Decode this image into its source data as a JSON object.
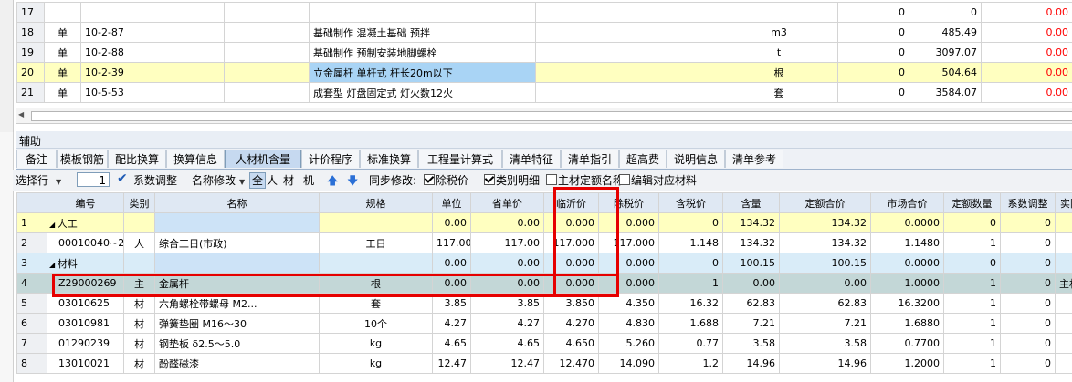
{
  "top_rows": [
    {
      "no": "17",
      "type": "",
      "code": "",
      "name": "",
      "unit": "",
      "qty": "0",
      "price": "0",
      "total": "0.00",
      "highlight": false
    },
    {
      "no": "18",
      "type": "单",
      "code": "10-2-87",
      "name": "基础制作 混凝土基础 预拌",
      "unit": "m3",
      "qty": "0",
      "price": "485.49",
      "total": "0.00",
      "highlight": false
    },
    {
      "no": "19",
      "type": "单",
      "code": "10-2-88",
      "name": "基础制作 预制安装地脚螺栓",
      "unit": "t",
      "qty": "0",
      "price": "3097.07",
      "total": "0.00",
      "highlight": false
    },
    {
      "no": "20",
      "type": "单",
      "code": "10-2-39",
      "name": "立金属杆 单杆式 杆长20m以下",
      "unit": "根",
      "qty": "0",
      "price": "504.64",
      "total": "0.00",
      "highlight": true
    },
    {
      "no": "21",
      "type": "单",
      "code": "10-5-53",
      "name": "成套型 灯盘固定式 灯火数12火",
      "unit": "套",
      "qty": "0",
      "price": "3584.07",
      "total": "0.00",
      "highlight": false
    }
  ],
  "panel_title": "辅助",
  "tabs": [
    "备注",
    "模板钢筋",
    "配比换算",
    "换算信息",
    "人材机含量",
    "计价程序",
    "标准换算",
    "工程量计算式",
    "清单特征",
    "清单指引",
    "超高费",
    "说明信息",
    "清单参考"
  ],
  "active_tab": "人材机含量",
  "toolbar": {
    "select_row_label": "选择行",
    "select_row_value": "1",
    "coef_adjust": "系数调整",
    "name_modify": "名称修改",
    "filter_all": "全",
    "filter_labor": "人",
    "filter_material": "材",
    "filter_machine": "机",
    "sync_label": "同步修改:",
    "chk_pretax": "除税价",
    "chk_category": "类别明细",
    "chk_main_material": "主材定额名称",
    "chk_edit_match": "编辑对应材料"
  },
  "columns": [
    "编号",
    "类别",
    "名称",
    "规格",
    "单位",
    "省单价",
    "临沂价",
    "除税价",
    "含税价",
    "含量",
    "定额合价",
    "市场合价",
    "定额数量",
    "系数调整",
    "实际数量",
    "类"
  ],
  "rows": [
    {
      "no": "1",
      "code": "人工",
      "cat": "",
      "name": "",
      "spec": "",
      "unit": "",
      "prov": "0.00",
      "linyi": "0.00",
      "pretax": "0.000",
      "taxed": "0.000",
      "content": "0",
      "quota_total": "134.32",
      "market_total": "134.32",
      "quota_qty": "0.0000",
      "coef": "0",
      "actual": "0",
      "extra": "",
      "style": "group-yellow"
    },
    {
      "no": "2",
      "code": "00010040~2",
      "cat": "人",
      "name": "综合工日(市政)",
      "spec": "",
      "unit": "工日",
      "prov": "117.00",
      "linyi": "117.00",
      "pretax": "117.000",
      "taxed": "117.000",
      "content": "1.148",
      "quota_total": "134.32",
      "market_total": "134.32",
      "quota_qty": "1.1480",
      "coef": "1",
      "actual": "0",
      "extra": "",
      "style": "normal"
    },
    {
      "no": "3",
      "code": "材料",
      "cat": "",
      "name": "",
      "spec": "",
      "unit": "",
      "prov": "0.00",
      "linyi": "0.00",
      "pretax": "0.000",
      "taxed": "0.000",
      "content": "0",
      "quota_total": "100.15",
      "market_total": "100.15",
      "quota_qty": "0.0000",
      "coef": "0",
      "actual": "0",
      "extra": "",
      "style": "group-blue"
    },
    {
      "no": "4",
      "code": "Z29000269",
      "cat": "主",
      "name": "金属杆",
      "spec": "",
      "unit": "根",
      "prov": "0.00",
      "linyi": "0.00",
      "pretax": "0.000",
      "taxed": "0.000",
      "content": "1",
      "quota_total": "0.00",
      "market_total": "0.00",
      "quota_qty": "1.0000",
      "coef": "1",
      "actual": "0",
      "extra": "主材",
      "style": "selected"
    },
    {
      "no": "5",
      "code": "03010625",
      "cat": "材",
      "name": "六角螺栓带螺母 M2...",
      "spec": "",
      "unit": "套",
      "prov": "3.85",
      "linyi": "3.85",
      "pretax": "3.850",
      "taxed": "4.350",
      "content": "16.32",
      "quota_total": "62.83",
      "market_total": "62.83",
      "quota_qty": "16.3200",
      "coef": "1",
      "actual": "0",
      "extra": "",
      "style": "normal"
    },
    {
      "no": "6",
      "code": "03010981",
      "cat": "材",
      "name": "弹簧垫圈 M16～30",
      "spec": "",
      "unit": "10个",
      "prov": "4.27",
      "linyi": "4.27",
      "pretax": "4.270",
      "taxed": "4.830",
      "content": "1.688",
      "quota_total": "7.21",
      "market_total": "7.21",
      "quota_qty": "1.6880",
      "coef": "1",
      "actual": "0",
      "extra": "",
      "style": "normal"
    },
    {
      "no": "7",
      "code": "01290239",
      "cat": "材",
      "name": "钢垫板 δ2.5～5.0",
      "spec": "",
      "unit": "kg",
      "prov": "4.65",
      "linyi": "4.65",
      "pretax": "4.650",
      "taxed": "5.260",
      "content": "0.77",
      "quota_total": "3.58",
      "market_total": "3.58",
      "quota_qty": "0.7700",
      "coef": "1",
      "actual": "0",
      "extra": "",
      "style": "normal"
    },
    {
      "no": "8",
      "code": "13010021",
      "cat": "材",
      "name": "酚醛磁漆",
      "spec": "",
      "unit": "kg",
      "prov": "12.47",
      "linyi": "12.47",
      "pretax": "12.470",
      "taxed": "14.090",
      "content": "1.2",
      "quota_total": "14.96",
      "market_total": "14.96",
      "quota_qty": "1.2000",
      "coef": "1",
      "actual": "0",
      "extra": "",
      "style": "normal"
    }
  ],
  "accent_colors": {
    "highlight_red": "#e60000",
    "selected_cell": "#a9d4f5",
    "group_yellow": "#ffffc0",
    "group_blue": "#d9ecf8",
    "row_selected": "#c3d7d7"
  }
}
